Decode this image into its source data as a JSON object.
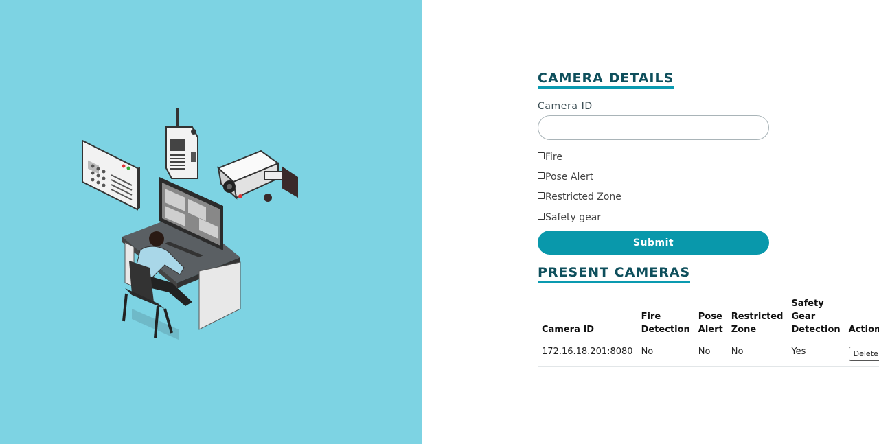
{
  "camera_details": {
    "title": "CAMERA DETAILS",
    "camera_id_label": "Camera ID",
    "camera_id_value": "",
    "checkboxes": [
      {
        "label": "Fire",
        "checked": false
      },
      {
        "label": "Pose Alert",
        "checked": false
      },
      {
        "label": "Restricted Zone",
        "checked": false
      },
      {
        "label": "Safety gear",
        "checked": false
      }
    ],
    "submit_label": "Submit"
  },
  "present_cameras": {
    "title": "PRESENT CAMERAS",
    "columns": [
      "Camera ID",
      "Fire Detection",
      "Pose Alert",
      "Restricted Zone",
      "Safety Gear Detection",
      "Actions"
    ],
    "rows": [
      {
        "camera_id": "172.16.18.201:8080",
        "fire": "No",
        "pose": "No",
        "restricted": "No",
        "safety": "Yes",
        "action": "Delete"
      }
    ]
  },
  "colors": {
    "left_panel_bg": "#7dd3e3",
    "accent": "#0998ab",
    "title_color": "#0e4f5c"
  }
}
